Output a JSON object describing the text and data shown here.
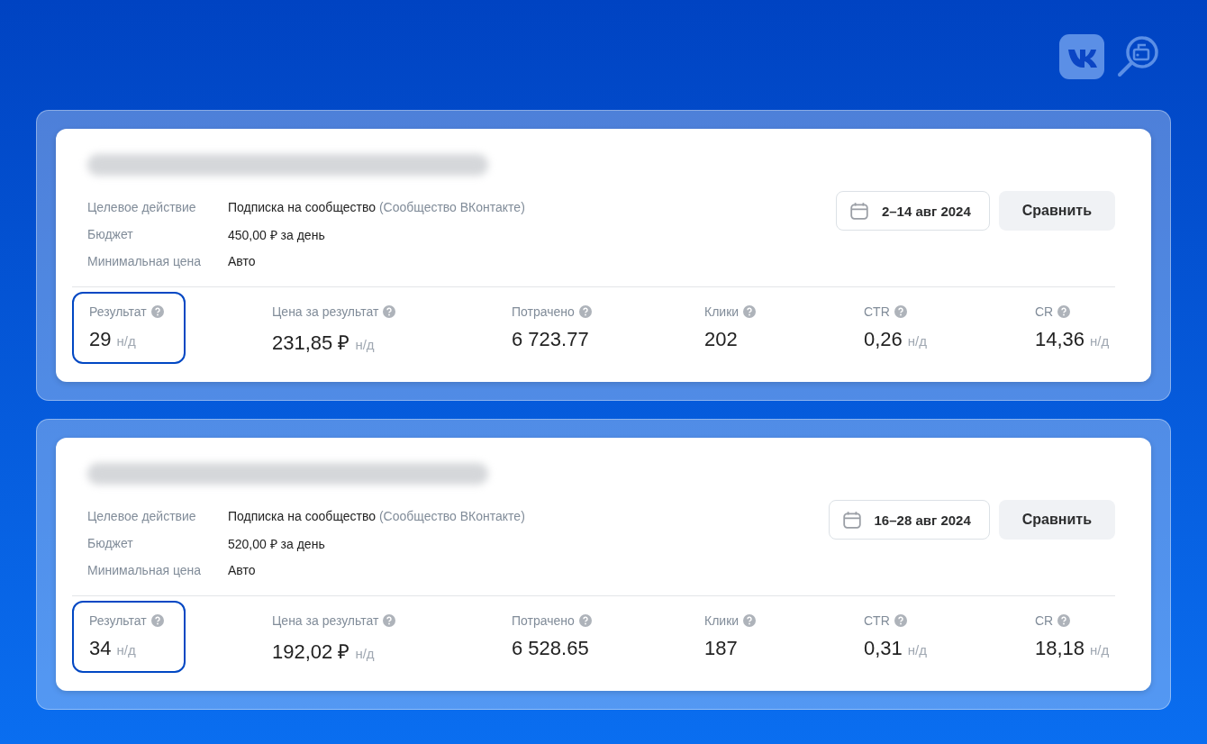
{
  "campaigns": [
    {
      "title": {
        "kind": "blurred"
      },
      "details": [
        {
          "label": "Целевое действие",
          "value": "Подписка на сообщество",
          "note": "(Сообщество ВКонтакте)"
        },
        {
          "label": "Бюджет",
          "value": "450,00 ₽ за день"
        },
        {
          "label": "Минимальная цена",
          "value": "Авто"
        }
      ],
      "date_range": "2–14 авг 2024",
      "compare_button": "Сравнить",
      "metrics": [
        {
          "label": "Результат",
          "value": "29",
          "suffix": "н/д",
          "highlighted": true
        },
        {
          "label": "Цена за результат",
          "value": "231,85 ₽",
          "suffix": "н/д",
          "highlighted": false
        },
        {
          "label": "Потрачено",
          "value": "6 723.77",
          "highlighted": false
        },
        {
          "label": "Клики",
          "value": "202",
          "highlighted": false
        },
        {
          "label": "CTR",
          "value": "0,26",
          "suffix": "н/д",
          "highlighted": false
        },
        {
          "label": "CR",
          "value": "14,36",
          "suffix": "н/д",
          "highlighted": false
        }
      ]
    },
    {
      "title": {
        "kind": "blurred"
      },
      "details": [
        {
          "label": "Целевое действие",
          "value": "Подписка на сообщество",
          "note": "(Сообщество ВКонтакте)"
        },
        {
          "label": "Бюджет",
          "value": "520,00 ₽ за день"
        },
        {
          "label": "Минимальная цена",
          "value": "Авто"
        }
      ],
      "date_range": "16–28 авг 2024",
      "compare_button": "Сравнить",
      "metrics": [
        {
          "label": "Результат",
          "value": "34",
          "suffix": "н/д",
          "highlighted": true
        },
        {
          "label": "Цена за результат",
          "value": "192,02 ₽",
          "suffix": "н/д",
          "highlighted": false
        },
        {
          "label": "Потрачено",
          "value": "6 528.65",
          "highlighted": false
        },
        {
          "label": "Клики",
          "value": "187",
          "highlighted": false
        },
        {
          "label": "CTR",
          "value": "0,31",
          "suffix": "н/д",
          "highlighted": false
        },
        {
          "label": "CR",
          "value": "18,18",
          "suffix": "н/д",
          "highlighted": false
        }
      ]
    }
  ]
}
